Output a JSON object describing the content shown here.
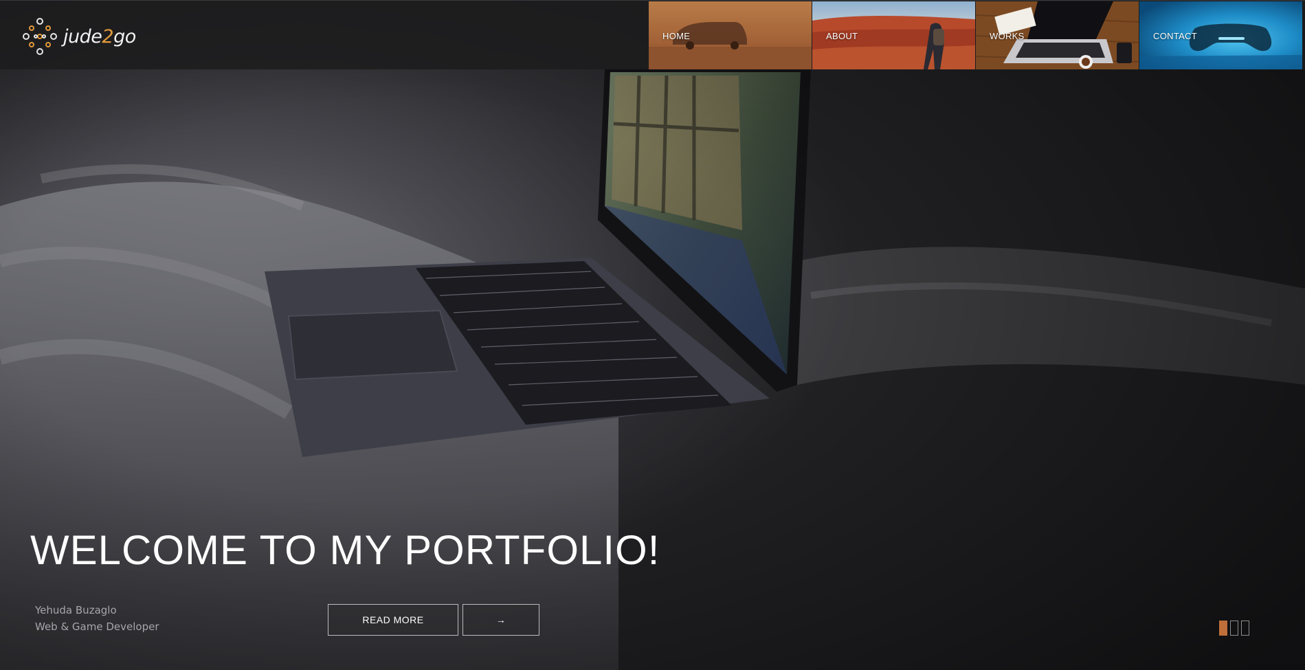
{
  "header": {
    "logo": {
      "text_main": "jude",
      "text_accent": "2",
      "text_end": "go"
    },
    "nav": [
      {
        "label": "HOME",
        "image": "van-sunset-image"
      },
      {
        "label": "ABOUT",
        "image": "hiker-landscape-image"
      },
      {
        "label": "WORKS",
        "image": "laptop-desk-image"
      },
      {
        "label": "CONTACT",
        "image": "gamepad-image"
      }
    ]
  },
  "hero": {
    "title": "WELCOME TO MY PORTFOLIO!",
    "author_name": "Yehuda Buzaglo",
    "author_role": "Web & Game Developer",
    "read_more_label": "READ MORE",
    "arrow_label": "→",
    "background": "laptop-on-bed-image"
  },
  "slider": {
    "count": 3,
    "active": 1
  },
  "colors": {
    "accent": "#e39a3a",
    "active_dot": "#c06e3a",
    "header_bg": "#1c1c1e"
  }
}
